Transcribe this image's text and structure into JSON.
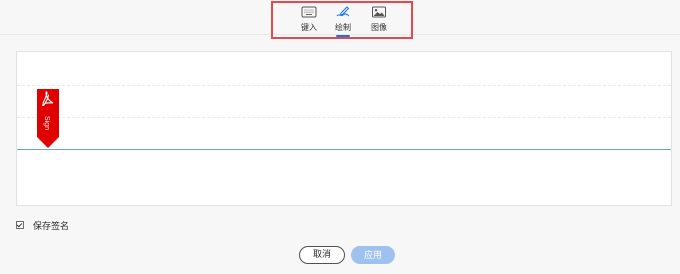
{
  "tabs": [
    {
      "label": "键入",
      "icon": "keyboard-icon",
      "active": false
    },
    {
      "label": "绘制",
      "icon": "draw-pen-icon",
      "active": true
    },
    {
      "label": "图像",
      "icon": "image-icon",
      "active": false
    }
  ],
  "canvas": {
    "flag_text": "Sign",
    "flag_icon": "acrobat-sign-icon"
  },
  "save_signature": {
    "label": "保存签名",
    "checked": true
  },
  "buttons": {
    "cancel": "取消",
    "apply": "应用"
  },
  "colors": {
    "accent": "#1473e6",
    "highlight_box": "#e5484d",
    "flag_red": "#e00000",
    "baseline": "#6aa6c9",
    "apply_disabled": "#9fc1ee"
  }
}
